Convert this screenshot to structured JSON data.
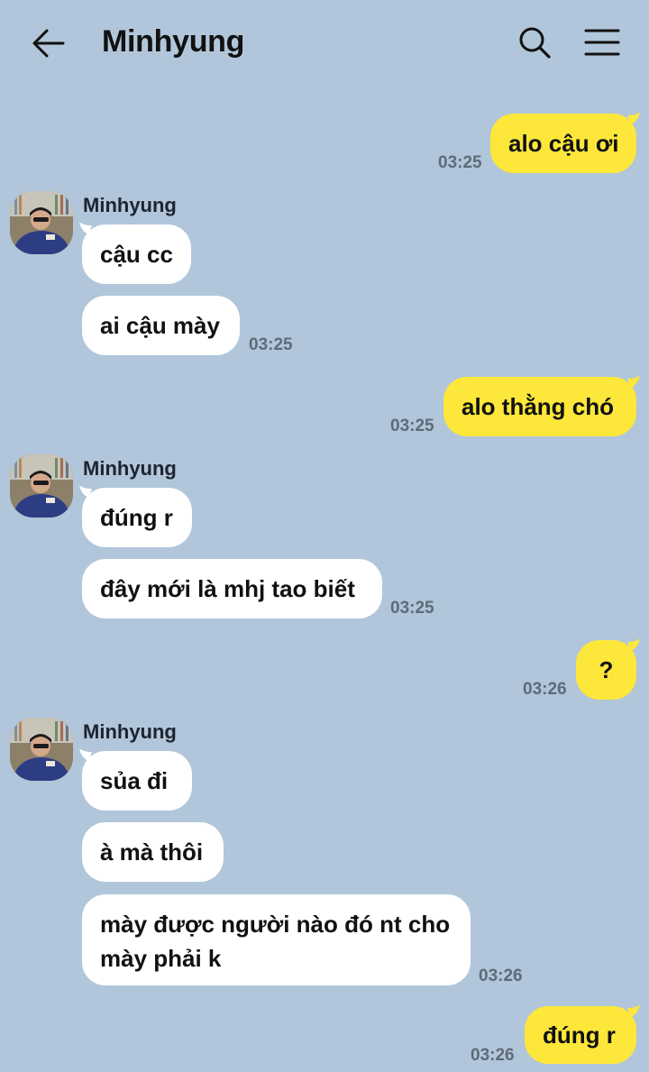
{
  "header": {
    "title": "Minhyung",
    "back_icon": "arrow-left-icon",
    "search_icon": "search-icon",
    "menu_icon": "hamburger-menu-icon"
  },
  "colors": {
    "background": "#b1c6da",
    "my_bubble": "#fde73a",
    "their_bubble": "#ffffff",
    "timestamp": "#5f6b78"
  },
  "messages": [
    {
      "from": "me",
      "text": "alo cậu ơi",
      "time": "03:25"
    },
    {
      "from": "them",
      "sender": "Minhyung",
      "texts": [
        "cậu cc",
        "ai cậu mày"
      ],
      "time": "03:25"
    },
    {
      "from": "me",
      "text": "alo thằng chó",
      "time": "03:25"
    },
    {
      "from": "them",
      "sender": "Minhyung",
      "texts": [
        "đúng r",
        "đây mới là mhj tao biết"
      ],
      "time": "03:25"
    },
    {
      "from": "me",
      "text": "?",
      "time": "03:26"
    },
    {
      "from": "them",
      "sender": "Minhyung",
      "texts": [
        "sủa đi",
        "à mà thôi",
        "mày được người nào đó nt cho mày phải k"
      ],
      "time": "03:26"
    },
    {
      "from": "me",
      "text": "đúng r",
      "time": "03:26"
    }
  ]
}
